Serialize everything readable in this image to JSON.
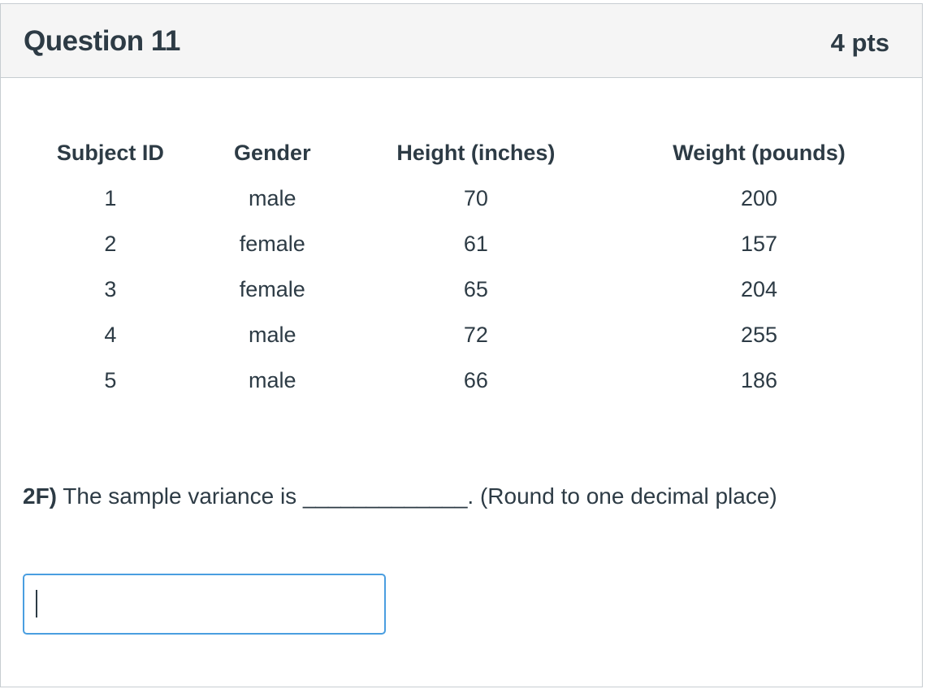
{
  "question": {
    "title": "Question 11",
    "points": "4 pts"
  },
  "table": {
    "headers": [
      "Subject ID",
      "Gender",
      "Height (inches)",
      "Weight (pounds)"
    ],
    "rows": [
      [
        "1",
        "male",
        "70",
        "200"
      ],
      [
        "2",
        "female",
        "61",
        "157"
      ],
      [
        "3",
        "female",
        "65",
        "204"
      ],
      [
        "4",
        "male",
        "72",
        "255"
      ],
      [
        "5",
        "male",
        "66",
        "186"
      ]
    ]
  },
  "prompt": {
    "label": "2F)",
    "text": " The sample variance is _____________. (Round to one decimal place)"
  },
  "answer": {
    "value": "",
    "placeholder": ""
  }
}
